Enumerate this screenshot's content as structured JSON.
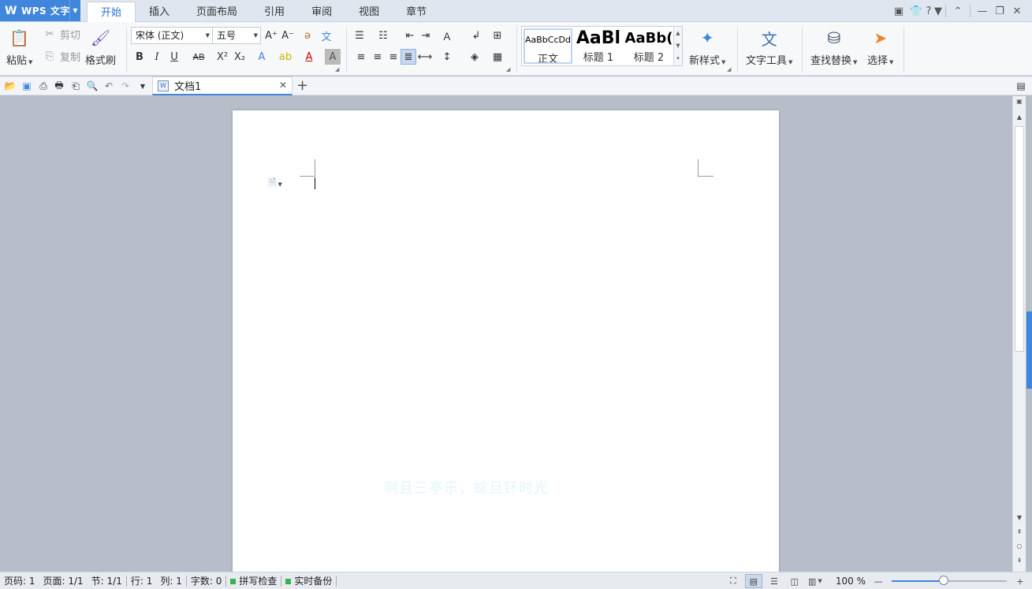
{
  "app": {
    "name": "WPS 文字"
  },
  "menu_tabs": [
    {
      "label": "开始",
      "active": true
    },
    {
      "label": "插入"
    },
    {
      "label": "页面布局"
    },
    {
      "label": "引用"
    },
    {
      "label": "审阅"
    },
    {
      "label": "视图"
    },
    {
      "label": "章节"
    }
  ],
  "window_controls": {
    "help": "?"
  },
  "ribbon": {
    "paste": "粘贴",
    "cut": "剪切",
    "copy": "复制",
    "format_painter": "格式刷",
    "font_name": "宋体 (正文)",
    "font_size": "五号",
    "styles": [
      {
        "preview": "AaBbCcDd",
        "name": "正文",
        "selected": true
      },
      {
        "preview": "AaBl",
        "name": "标题 1"
      },
      {
        "preview": "AaBb(",
        "name": "标题 2"
      }
    ],
    "new_style": "新样式",
    "text_tools": "文字工具",
    "find_replace": "查找替换",
    "select": "选择"
  },
  "document_tabs": [
    {
      "title": "文档1",
      "active": true
    }
  ],
  "document": {
    "watermark": "啊且三亭乐，蜍旦钚时光"
  },
  "status": {
    "page": "页码: 1",
    "page_of": "页面: 1/1",
    "section": "节: 1/1",
    "line": "行: 1",
    "column": "列: 1",
    "word_count": "字数: 0",
    "spell_check": "拼写检查",
    "backup": "实时备份",
    "zoom_label": "100 %",
    "zoom_fraction": 0.45
  },
  "colors": {
    "accent": "#3f86dc",
    "tab_bar": "#dfe6f0",
    "ribbon_bg": "#f7f8fa",
    "canvas_bg": "#b8bec9",
    "status_green": "#38b24a"
  }
}
